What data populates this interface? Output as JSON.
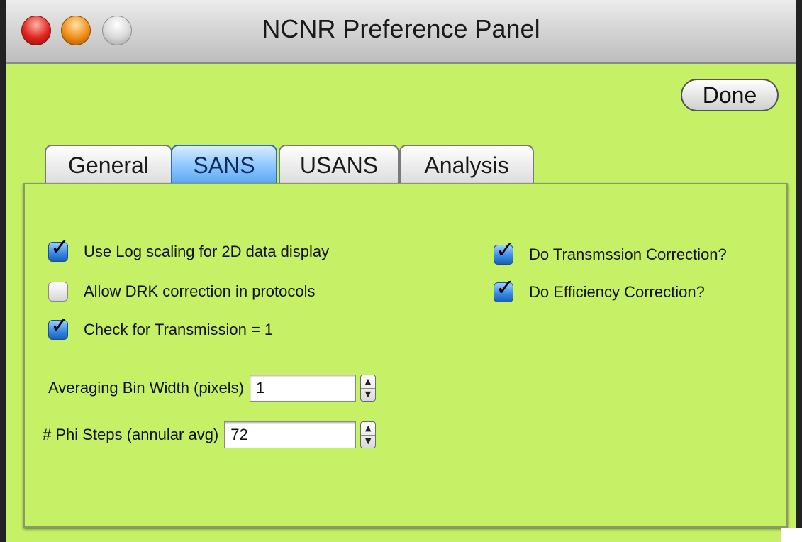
{
  "window": {
    "title": "NCNR Preference Panel",
    "background_color": "#c6f066"
  },
  "toolbar": {
    "done_label": "Done"
  },
  "tabs": [
    {
      "label": "General",
      "active": false
    },
    {
      "label": "SANS",
      "active": true
    },
    {
      "label": "USANS",
      "active": false
    },
    {
      "label": "Analysis",
      "active": false
    }
  ],
  "left_checkboxes": [
    {
      "label": "Use Log scaling for 2D data display",
      "checked": true
    },
    {
      "label": "Allow DRK correction in protocols",
      "checked": false
    },
    {
      "label": "Check for Transmission = 1",
      "checked": true
    }
  ],
  "right_checkboxes": [
    {
      "label": "Do Transmssion Correction?",
      "checked": true
    },
    {
      "label": "Do Efficiency Correction?",
      "checked": true
    }
  ],
  "fields": {
    "bin_width": {
      "label": "Averaging Bin Width (pixels)",
      "value": "1"
    },
    "phi_steps": {
      "label": "# Phi Steps (annular avg)",
      "value": "72"
    }
  },
  "icons": {
    "close": "close-traffic-light-icon",
    "minimize": "minimize-traffic-light-icon",
    "zoom": "zoom-traffic-light-icon",
    "check": "checkmark-icon",
    "stepper_up": "triangle-up-icon",
    "stepper_down": "triangle-down-icon"
  }
}
